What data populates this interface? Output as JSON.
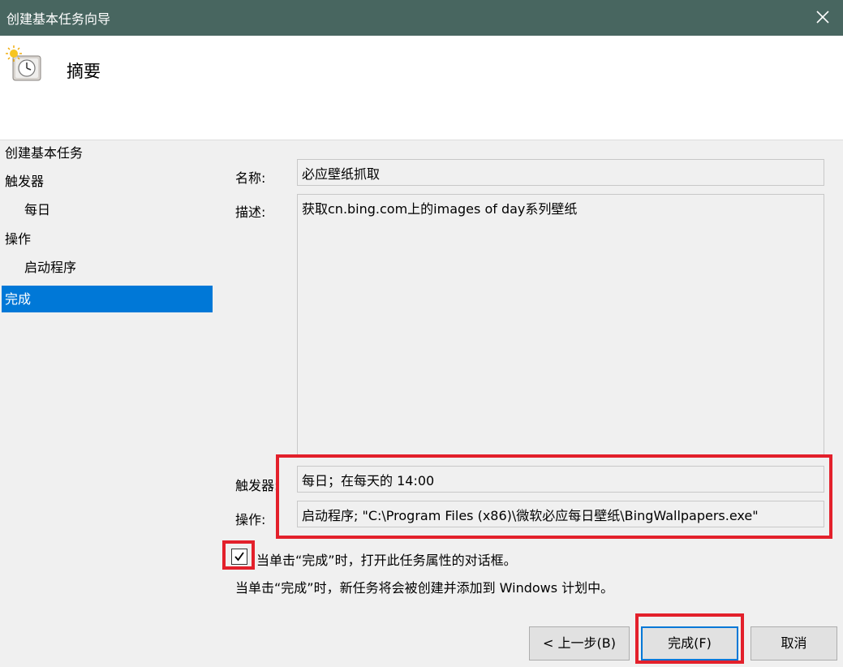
{
  "window": {
    "title": "创建基本任务向导"
  },
  "header": {
    "title": "摘要",
    "icon": "scheduled-task-clock-icon"
  },
  "sidebar": {
    "items": [
      {
        "label": "创建基本任务"
      },
      {
        "label": "触发器"
      },
      {
        "label": "每日"
      },
      {
        "label": "操作"
      },
      {
        "label": "启动程序"
      },
      {
        "label": "完成"
      }
    ],
    "active_item": "完成"
  },
  "summary": {
    "name_label": "名称:",
    "name_value": "必应壁纸抓取",
    "description_label": "描述:",
    "description_value": "获取cn.bing.com上的images of day系列壁纸",
    "trigger_label": "触发器:",
    "trigger_value": "每日；在每天的 14:00",
    "action_label": "操作:",
    "action_value": "启动程序; \"C:\\Program Files (x86)\\微软必应每日壁纸\\BingWallpapers.exe\""
  },
  "options": {
    "open_properties_label": "当单击“完成”时，打开此任务属性的对话框。",
    "open_properties_checked": true,
    "info_text": "当单击“完成”时，新任务将会被创建并添加到 Windows 计划中。"
  },
  "buttons": {
    "back": "< 上一步(B)",
    "finish": "完成(F)",
    "cancel": "取消"
  },
  "colors": {
    "titlebar": "#486660",
    "selection": "#0078d7",
    "highlight_annotation": "#e3202b"
  }
}
